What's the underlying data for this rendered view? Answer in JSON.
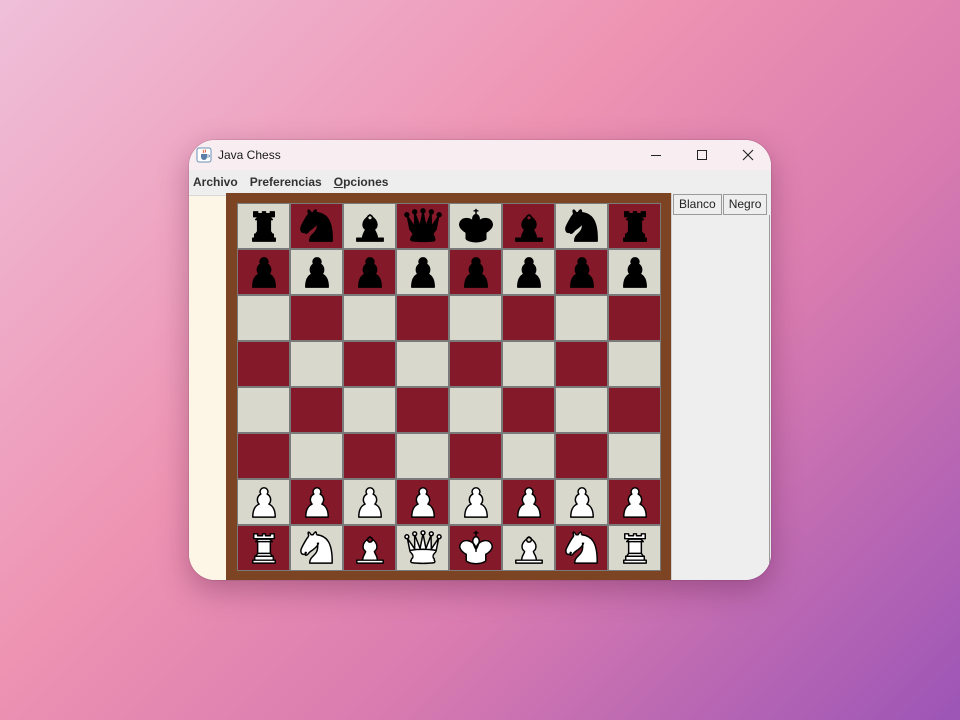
{
  "window": {
    "title": "Java Chess",
    "app_icon": "java-cup-icon"
  },
  "window_controls": [
    "minimize-icon",
    "maximize-icon",
    "close-icon"
  ],
  "menu": [
    {
      "label": "Archivo",
      "mnemonic": false
    },
    {
      "label": "Preferencias",
      "mnemonic": false
    },
    {
      "label": "Opciones",
      "mnemonic": true
    }
  ],
  "side_tabs": [
    {
      "label": "Blanco"
    },
    {
      "label": "Negro"
    }
  ],
  "colors": {
    "light_square": "#d8d8cc",
    "dark_square": "#84192a",
    "board_border": "#7c4423",
    "left_pane": "#fdf6e6"
  },
  "board": [
    [
      "bR",
      "bN",
      "bB",
      "bQ",
      "bK",
      "bB",
      "bN",
      "bR"
    ],
    [
      "bP",
      "bP",
      "bP",
      "bP",
      "bP",
      "bP",
      "bP",
      "bP"
    ],
    [
      "",
      "",
      "",
      "",
      "",
      "",
      "",
      ""
    ],
    [
      "",
      "",
      "",
      "",
      "",
      "",
      "",
      ""
    ],
    [
      "",
      "",
      "",
      "",
      "",
      "",
      "",
      ""
    ],
    [
      "",
      "",
      "",
      "",
      "",
      "",
      "",
      ""
    ],
    [
      "wP",
      "wP",
      "wP",
      "wP",
      "wP",
      "wP",
      "wP",
      "wP"
    ],
    [
      "wR",
      "wN",
      "wB",
      "wQ",
      "wK",
      "wB",
      "wN",
      "wR"
    ]
  ]
}
